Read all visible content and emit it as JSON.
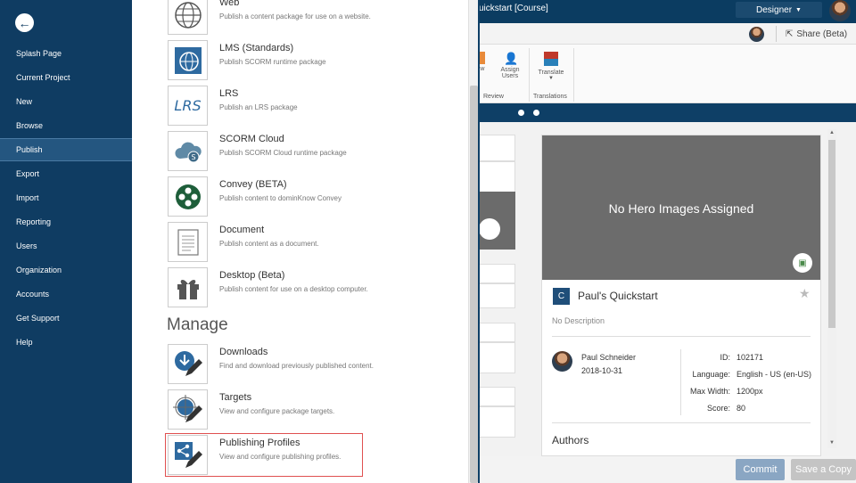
{
  "app": {
    "course_title": "uickstart [Course]",
    "designer_label": "Designer",
    "share_label": "Share (Beta)",
    "ribbon": {
      "item1_label": "ew",
      "assign_label_1": "Assign",
      "assign_label_2": "Users",
      "translate_label": "Translate",
      "group_review": "Review",
      "group_translations": "Translations"
    },
    "hero_text": "No Hero Images Assigned",
    "project": {
      "badge": "C",
      "title": "Paul's Quickstart",
      "description": "No Description",
      "author_name": "Paul Schneider",
      "author_date": "2018-10-31",
      "meta": [
        {
          "label": "ID:",
          "value": "102171"
        },
        {
          "label": "Language:",
          "value": "English - US (en-US)"
        },
        {
          "label": "Max Width:",
          "value": "1200px"
        },
        {
          "label": "Score:",
          "value": "80"
        }
      ],
      "authors_heading": "Authors"
    },
    "footer": {
      "commit_label": "Commit",
      "save_copy_label": "Save a Copy"
    },
    "colors": {
      "nav_bg": "#0f3c62",
      "accent_blue": "#0e3f66",
      "commit_btn": "#8aa6c3",
      "highlight_border": "#e05050"
    }
  },
  "nav": {
    "items": [
      {
        "label": "Splash Page"
      },
      {
        "label": "Current Project"
      },
      {
        "label": "New"
      },
      {
        "label": "Browse"
      },
      {
        "label": "Publish",
        "active": true
      },
      {
        "label": "Export"
      },
      {
        "label": "Import"
      },
      {
        "label": "Reporting"
      },
      {
        "label": "Users"
      },
      {
        "label": "Organization"
      },
      {
        "label": "Accounts"
      },
      {
        "label": "Get Support"
      },
      {
        "label": "Help"
      }
    ]
  },
  "publish": {
    "options": [
      {
        "title": "Web",
        "desc": "Publish a content package for use on a website.",
        "icon": "globe-icon"
      },
      {
        "title": "LMS (Standards)",
        "desc": "Publish SCORM runtime package",
        "icon": "lms-globe-icon"
      },
      {
        "title": "LRS",
        "desc": "Publish an LRS package",
        "icon": "lrs-icon"
      },
      {
        "title": "SCORM Cloud",
        "desc": "Publish SCORM Cloud runtime package",
        "icon": "cloud-icon"
      },
      {
        "title": "Convey (BETA)",
        "desc": "Publish content to dominKnow Convey",
        "icon": "convey-icon"
      },
      {
        "title": "Document",
        "desc": "Publish content as a document.",
        "icon": "document-icon"
      },
      {
        "title": "Desktop (Beta)",
        "desc": "Publish content for use on a desktop computer.",
        "icon": "gift-icon"
      }
    ],
    "manage_heading": "Manage",
    "manage": [
      {
        "title": "Downloads",
        "desc": "Find and download previously published content.",
        "icon": "download-edit-icon"
      },
      {
        "title": "Targets",
        "desc": "View and configure package targets.",
        "icon": "target-edit-icon"
      },
      {
        "title": "Publishing Profiles",
        "desc": "View and configure publishing profiles.",
        "icon": "share-edit-icon"
      }
    ],
    "lrs_icon_text": "LRS"
  }
}
